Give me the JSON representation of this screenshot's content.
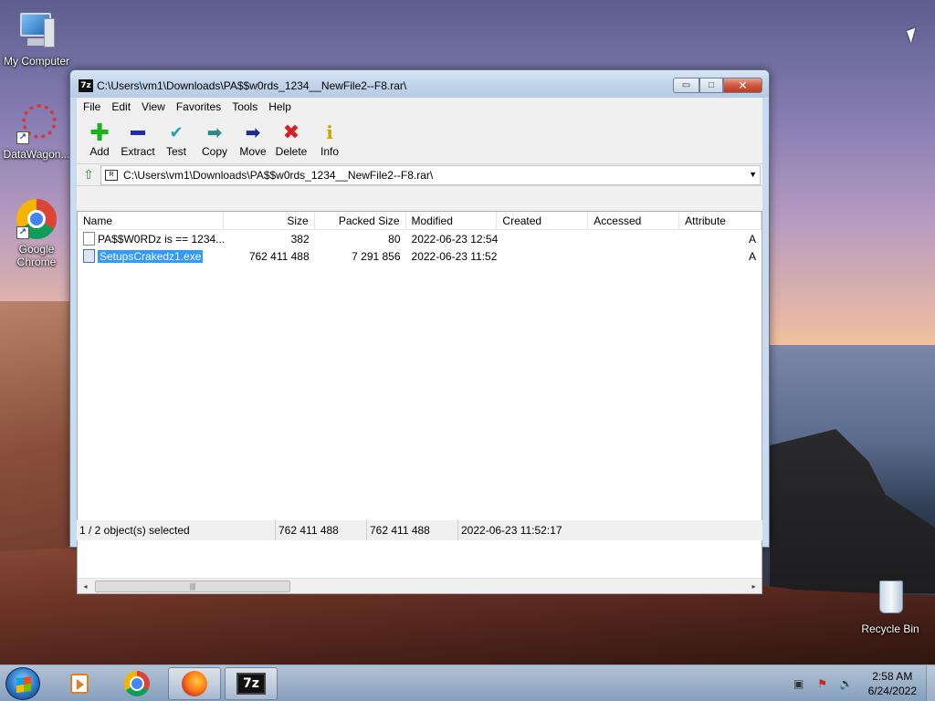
{
  "desktop": {
    "icons": [
      {
        "label": "My Computer",
        "icon": "computer-icon"
      },
      {
        "label": "DataWagon...",
        "icon": "datawagon-icon"
      },
      {
        "label": "Google Chrome",
        "icon": "chrome-icon"
      },
      {
        "label": "Recycle Bin",
        "icon": "recycle-bin-icon"
      }
    ]
  },
  "window": {
    "title": "C:\\Users\\vm1\\Downloads\\PA$$w0rds_1234__NewFile2--F8.rar\\",
    "app_icon": "7z",
    "buttons": {
      "minimize": "▭",
      "maximize": "□",
      "close": "✕"
    }
  },
  "menu": [
    "File",
    "Edit",
    "View",
    "Favorites",
    "Tools",
    "Help"
  ],
  "toolbar": [
    {
      "label": "Add",
      "icon": "plus-icon",
      "glyph": "✚"
    },
    {
      "label": "Extract",
      "icon": "minus-icon",
      "glyph": ""
    },
    {
      "label": "Test",
      "icon": "checkmark-icon",
      "glyph": "✔"
    },
    {
      "label": "Copy",
      "icon": "copy-arrow-icon",
      "glyph": "➡"
    },
    {
      "label": "Move",
      "icon": "move-arrow-icon",
      "glyph": "➡"
    },
    {
      "label": "Delete",
      "icon": "delete-x-icon",
      "glyph": "✖"
    },
    {
      "label": "Info",
      "icon": "info-icon",
      "glyph": "i"
    }
  ],
  "address": {
    "path": "C:\\Users\\vm1\\Downloads\\PA$$w0rds_1234__NewFile2--F8.rar\\",
    "up_glyph": "⇧",
    "drop_glyph": "▼"
  },
  "columns": [
    "Name",
    "Size",
    "Packed Size",
    "Modified",
    "Created",
    "Accessed",
    "Attribute"
  ],
  "files": [
    {
      "name": "PA$$W0RDz is  ==  1234...",
      "size": "382",
      "packed": "80",
      "modified": "2022-06-23 12:54",
      "created": "",
      "accessed": "",
      "attr": "A",
      "selected": false
    },
    {
      "name": "SetupsCrakedz1.exe",
      "size": "762 411 488",
      "packed": "7 291 856",
      "modified": "2022-06-23 11:52",
      "created": "",
      "accessed": "",
      "attr": "A",
      "selected": true
    }
  ],
  "scroll": {
    "left": "◂",
    "right": "▸",
    "thumb": "|||"
  },
  "status": {
    "selection": "1 / 2 object(s) selected",
    "size": "762 411 488",
    "packed": "762 411 488",
    "modified": "2022-06-23 11:52:17"
  },
  "taskbar": {
    "items": [
      "windows-media-player-icon",
      "chrome-icon",
      "firefox-icon",
      "7zip-icon"
    ],
    "sevenzip_label": "7z",
    "tray": {
      "network": "▣",
      "flag": "⚑",
      "volume": "🔈"
    },
    "time": "2:58 AM",
    "date": "6/24/2022"
  }
}
